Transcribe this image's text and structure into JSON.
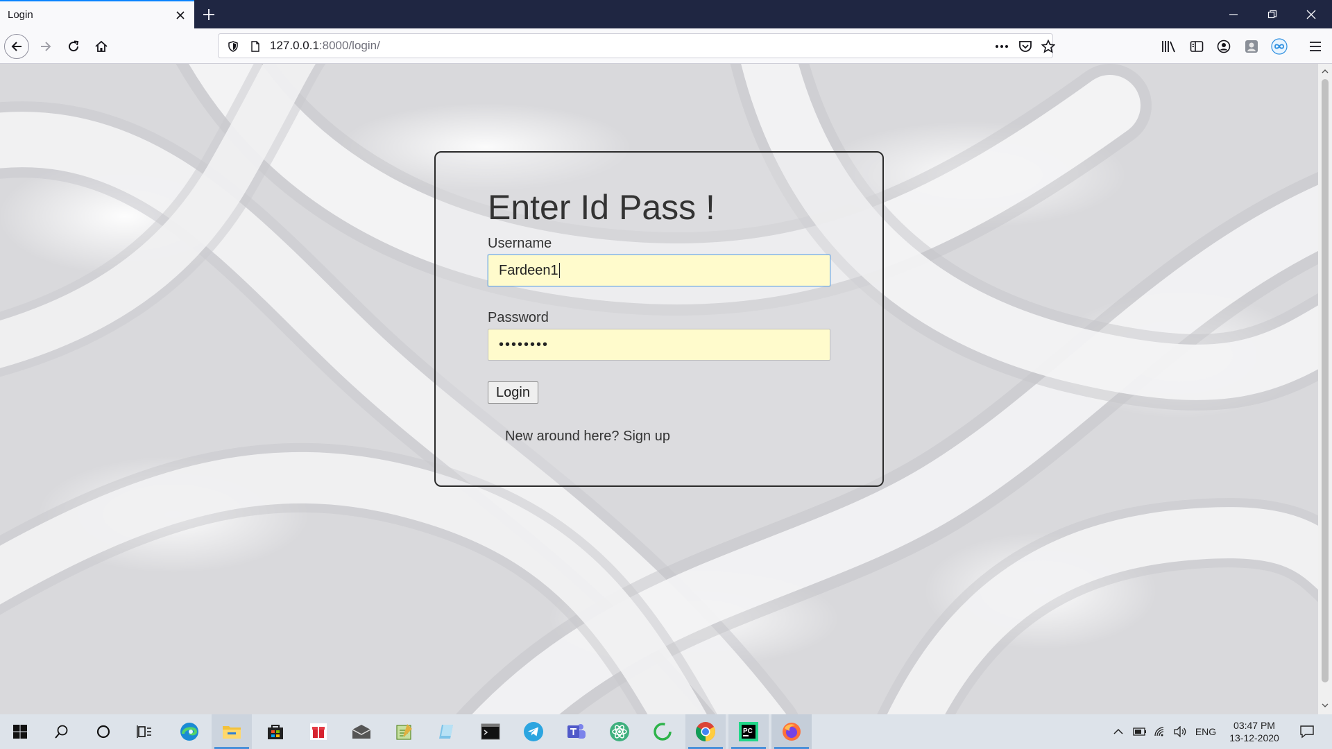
{
  "browser": {
    "tab_title": "Login",
    "url_host": "127.0.0.1",
    "url_rest": ":8000/login/"
  },
  "login": {
    "heading": "Enter Id Pass !",
    "username_label": "Username",
    "username_value": "Fardeen1",
    "password_label": "Password",
    "password_mask": "••••••••",
    "login_button": "Login",
    "signup_text": "New around here? Sign up"
  },
  "taskbar": {
    "language": "ENG",
    "time": "03:47 PM",
    "date": "13-12-2020",
    "apps": [
      "start",
      "search",
      "cortana",
      "task-view",
      "edge",
      "file-explorer",
      "store",
      "gift",
      "mail",
      "notepad",
      "app",
      "terminal",
      "telegram",
      "teams",
      "atom",
      "spinner",
      "chrome",
      "pycharm",
      "firefox"
    ]
  },
  "colors": {
    "tabbar": "#1f2642",
    "input_bg": "#fffbcc",
    "accent": "#0a84ff"
  }
}
